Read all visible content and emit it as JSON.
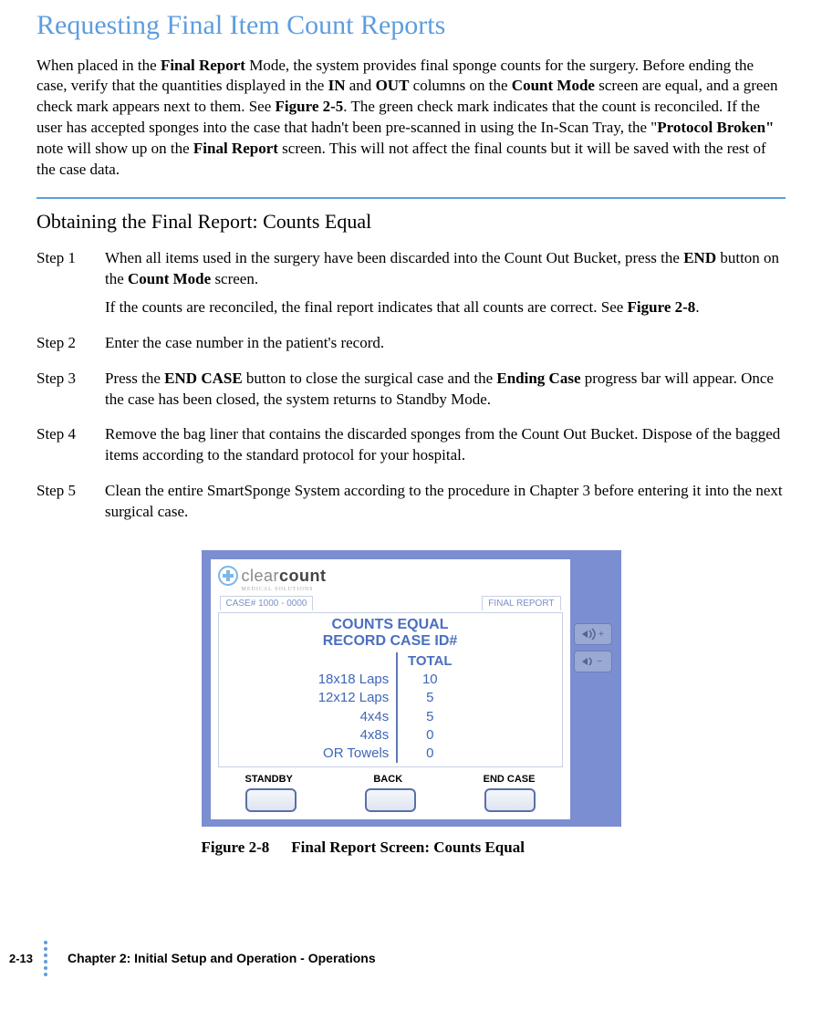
{
  "section_title": "Requesting Final Item Count Reports",
  "intro": {
    "p1a": "When placed in the ",
    "b1": "Final Report",
    "p1b": " Mode, the system provides final sponge counts for the surgery. Before ending the case, verify that the quantities displayed in the ",
    "b2": "IN",
    "p1c": " and ",
    "b3": "OUT",
    "p1d": " columns on the ",
    "b4": "Count Mode",
    "p1e": " screen are equal, and a green check mark appears next to them. See ",
    "b5": "Figure 2-5",
    "p1f": ". The green check mark indicates that the count is reconciled. If the user has accepted sponges into the case that hadn't been pre-scanned in using the In-Scan Tray, the \"",
    "b6": "Protocol Broken\"",
    "p1g": " note will show up on the ",
    "b7": "Final Report",
    "p1h": " screen. This will not affect the final counts but it will be saved with the rest of the case data."
  },
  "subhead": "Obtaining the Final Report: Counts Equal",
  "steps": [
    {
      "label": "Step 1",
      "body": [
        {
          "t": "When all items used in the surgery have been discarded into the Count Out Bucket, press the "
        },
        {
          "b": "END"
        },
        {
          "t": " button on the "
        },
        {
          "b": "Count Mode"
        },
        {
          "t": " screen."
        }
      ],
      "extra": [
        {
          "t": "If the counts are reconciled, the final report indicates that all counts are correct. See "
        },
        {
          "b": "Figure 2-8"
        },
        {
          "t": "."
        }
      ]
    },
    {
      "label": "Step 2",
      "body": [
        {
          "t": "Enter the case number in the patient's record."
        }
      ]
    },
    {
      "label": "Step 3",
      "body": [
        {
          "t": "Press the "
        },
        {
          "b": "END CASE"
        },
        {
          "t": " button to close the surgical case and the "
        },
        {
          "b": "Ending Case"
        },
        {
          "t": " progress bar will appear. Once the case has been closed, the system returns to Standby Mode."
        }
      ]
    },
    {
      "label": "Step 4",
      "body": [
        {
          "t": "Remove the bag liner that contains the discarded sponges from the Count Out Bucket. Dispose of the bagged items according to the standard protocol for your hospital."
        }
      ]
    },
    {
      "label": "Step 5",
      "body": [
        {
          "t": "Clean the entire SmartSponge System according to the procedure in Chapter 3 before entering it into the next surgical case."
        }
      ]
    }
  ],
  "figure": {
    "brand_light": "clear",
    "brand_bold": "count",
    "brand_sub": "MEDICAL SOLUTIONS",
    "case_id": "CASE# 1000 - 0000",
    "mode": "FINAL REPORT",
    "headline1": "COUNTS EQUAL",
    "headline2": "RECORD CASE ID#",
    "total_label": "TOTAL",
    "rows": [
      {
        "label": "18x18 Laps",
        "value": "10"
      },
      {
        "label": "12x12 Laps",
        "value": "5"
      },
      {
        "label": "4x4s",
        "value": "5"
      },
      {
        "label": "4x8s",
        "value": "0"
      },
      {
        "label": "OR Towels",
        "value": "0"
      }
    ],
    "btn_standby": "STANDBY",
    "btn_back": "BACK",
    "btn_endcase": "END CASE",
    "caption_num": "Figure 2-8",
    "caption_title": "Final Report Screen: Counts Equal"
  },
  "footer": {
    "page": "2-13",
    "chapter": "Chapter 2: Initial Setup and Operation - Operations"
  }
}
